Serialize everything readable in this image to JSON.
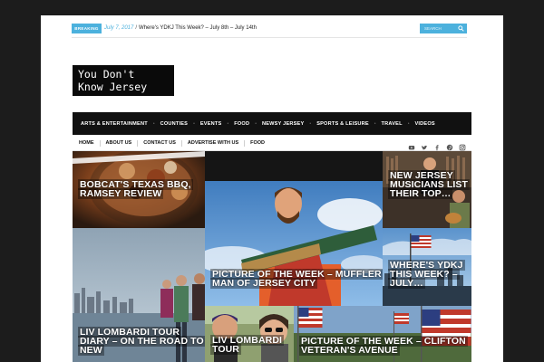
{
  "topbar": {
    "breaking_label": "BREAKING",
    "date": "July 7, 2017",
    "separator": "/",
    "headline": "Where's YDKJ This Week? – July 8th – July 14th",
    "search_placeholder": "SEARCH",
    "accent": "#4cb1dd"
  },
  "logo": {
    "text": "You Don't\nKnow Jersey"
  },
  "main_nav": {
    "items": [
      "ARTS & ENTERTAINMENT",
      "COUNTIES",
      "EVENTS",
      "FOOD",
      "NEWSY JERSEY",
      "SPORTS & LEISURE",
      "TRAVEL",
      "VIDEOS"
    ]
  },
  "sub_nav": {
    "items": [
      "HOME",
      "ABOUT US",
      "CONTACT US",
      "ADVERTISE WITH US",
      "FOOD"
    ],
    "social_icons": [
      "youtube-icon",
      "twitter-icon",
      "facebook-icon",
      "pinterest-icon",
      "instagram-icon"
    ]
  },
  "tiles": [
    {
      "id": "bobcat",
      "title": "BOBCAT'S TEXAS BBQ, RAMSEY REVIEW"
    },
    {
      "id": "muffler",
      "title": "PICTURE OF THE WEEK – MUFFLER MAN OF JERSEY CITY"
    },
    {
      "id": "musicians",
      "title": "NEW JERSEY MUSICIANS LIST THEIR TOP…"
    },
    {
      "id": "ydkj",
      "title": "WHERE'S YDKJ THIS WEEK? – JULY…"
    },
    {
      "id": "tour",
      "title": "LIV LOMBARDI TOUR DIARY – ON THE ROAD TO NEW"
    },
    {
      "id": "tour2",
      "title": "LIV LOMBARDI TOUR"
    },
    {
      "id": "clifton",
      "title": "PICTURE OF THE WEEK – CLIFTON VETERAN'S AVENUE"
    }
  ]
}
